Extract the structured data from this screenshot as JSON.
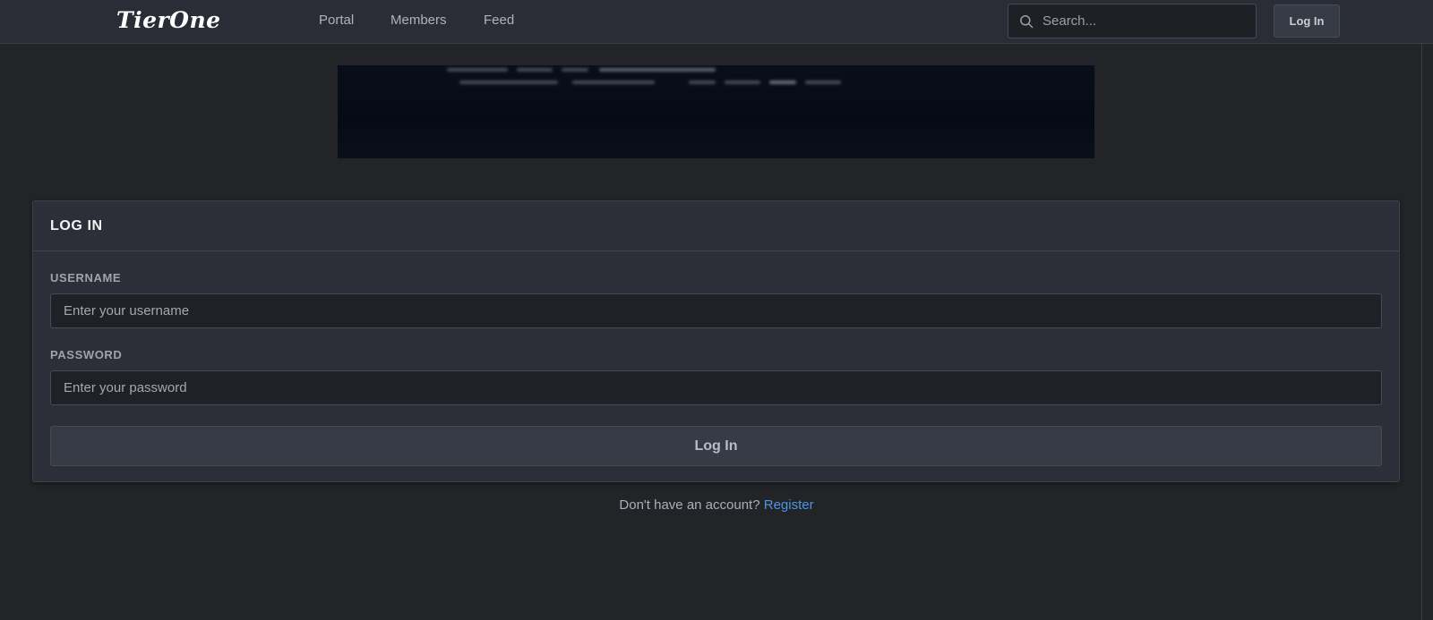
{
  "header": {
    "logo_text": "TierOne",
    "nav": [
      {
        "label": "Portal"
      },
      {
        "label": "Members"
      },
      {
        "label": "Feed"
      }
    ],
    "search": {
      "placeholder": "Search..."
    },
    "login_label": "Log In"
  },
  "login": {
    "title": "LOG IN",
    "username": {
      "label": "USERNAME",
      "placeholder": "Enter your username"
    },
    "password": {
      "label": "PASSWORD",
      "placeholder": "Enter your password"
    },
    "submit_label": "Log In"
  },
  "footer": {
    "prompt": "Don't have an account?",
    "register_label": "Register"
  },
  "colors": {
    "background": "#232428",
    "panel": "#2c2f37",
    "link": "#4a95e6"
  }
}
